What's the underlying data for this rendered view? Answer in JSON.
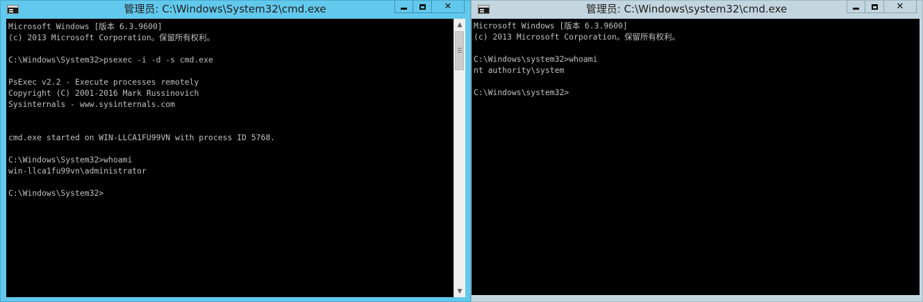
{
  "left_window": {
    "title": "管理员: C:\\Windows\\System32\\cmd.exe",
    "icon": "console-icon",
    "controls": {
      "minimize": "minimize-icon",
      "maximize": "maximize-icon",
      "close": "close-icon"
    },
    "console_text": "Microsoft Windows [版本 6.3.9600]\n(c) 2013 Microsoft Corporation。保留所有权利。\n\nC:\\Windows\\System32>psexec -i -d -s cmd.exe\n\nPsExec v2.2 - Execute processes remotely\nCopyright (C) 2001-2016 Mark Russinovich\nSysinternals - www.sysinternals.com\n\n\ncmd.exe started on WIN-LLCA1FU99VN with process ID 5768.\n\nC:\\Windows\\System32>whoami\nwin-llca1fu99vn\\administrator\n\nC:\\Windows\\System32>",
    "scroll_up_glyph": "▲",
    "scroll_down_glyph": "▼"
  },
  "right_window": {
    "title": "管理员: C:\\Windows\\system32\\cmd.exe",
    "icon": "console-icon",
    "controls": {
      "minimize": "minimize-icon",
      "maximize": "maximize-icon",
      "close": "close-icon"
    },
    "console_text": "Microsoft Windows [版本 6.3.9600]\n(c) 2013 Microsoft Corporation。保留所有权利。\n\nC:\\Windows\\system32>whoami\nnt authority\\system\n\nC:\\Windows\\system32>"
  },
  "colors": {
    "active_titlebar": "#63c9ec",
    "inactive_titlebar": "#c3d6df",
    "console_background": "#000000",
    "console_text": "#c0c0c0"
  },
  "glyphs": {
    "close": "✕"
  }
}
